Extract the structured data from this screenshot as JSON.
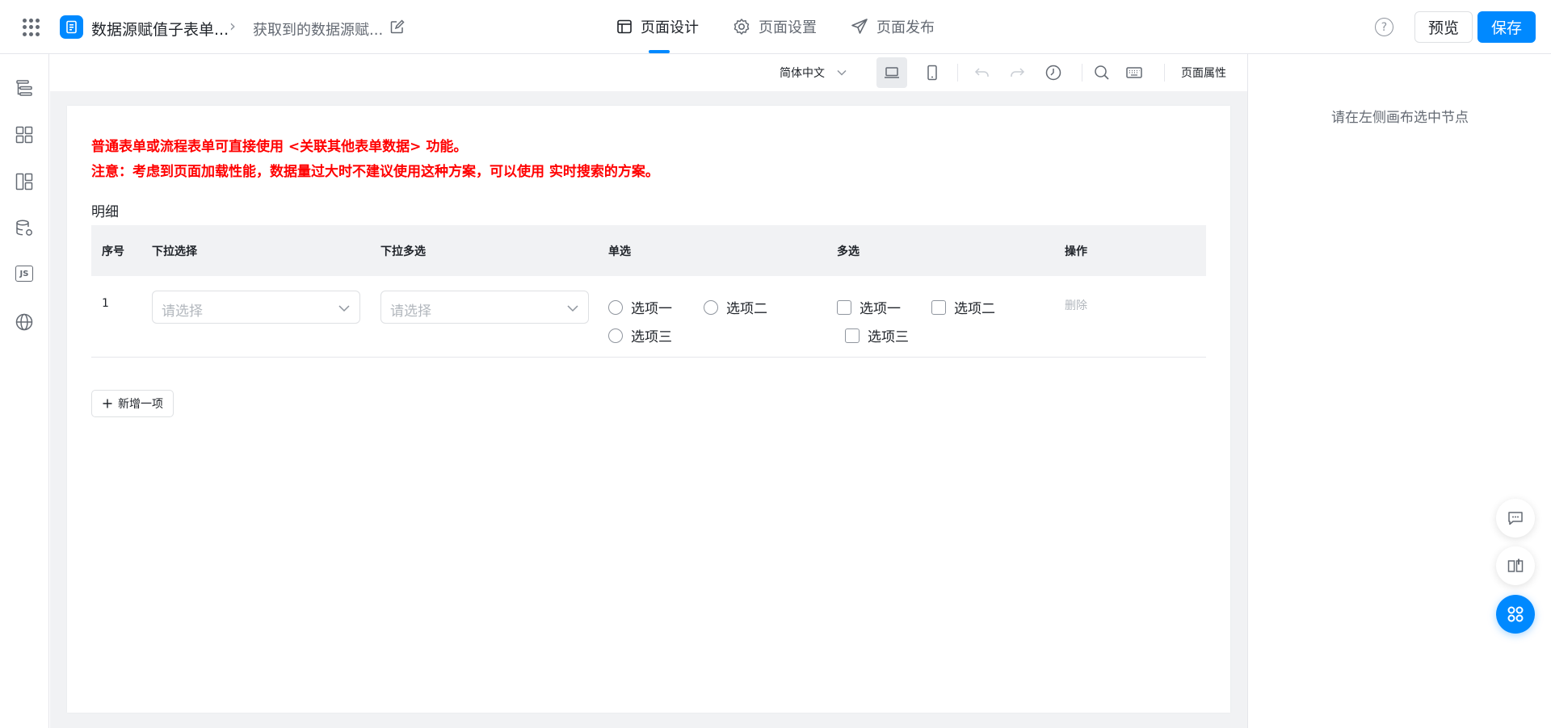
{
  "header": {
    "app_title": "数据源赋值子表单...",
    "page_name": "获取到的数据源赋...",
    "tabs": [
      {
        "label": "页面设计",
        "icon": "layout-icon",
        "active": true
      },
      {
        "label": "页面设置",
        "icon": "gear-icon",
        "active": false
      },
      {
        "label": "页面发布",
        "icon": "send-icon",
        "active": false
      }
    ],
    "help_label": "?",
    "preview_label": "预览",
    "save_label": "保存",
    "accent_color": "#0089ff"
  },
  "left_sidebar": {
    "icons": [
      "outline-tree-icon",
      "components-grid-icon",
      "layout-blocks-icon",
      "data-source-icon",
      "js-icon",
      "globe-icon"
    ],
    "js_label": "JS"
  },
  "toolbar": {
    "language": "简体中文",
    "device": "desktop",
    "page_props_label": "页面属性"
  },
  "canvas": {
    "notice_line1": "普通表单或流程表单可直接使用 <关联其他表单数据> 功能。",
    "notice_line2": "注意：考虑到页面加载性能，数据量过大时不建议使用这种方案，可以使用 实时搜索的方案。",
    "notice_color": "#ff0000",
    "section_title": "明细",
    "table": {
      "columns": [
        "序号",
        "下拉选择",
        "下拉多选",
        "单选",
        "多选",
        "操作"
      ],
      "rows": [
        {
          "index": "1",
          "select_placeholder": "请选择",
          "multiselect_placeholder": "请选择",
          "radio_options": [
            "选项一",
            "选项二",
            "选项三"
          ],
          "checkbox_options": [
            "选项一",
            "选项二",
            "选项三"
          ],
          "action": "删除"
        }
      ]
    },
    "add_item_label": "新增一项"
  },
  "right_panel": {
    "hint": "请在左侧画布选中节点"
  },
  "floating_buttons": [
    "feedback-icon",
    "guide-book-icon",
    "apps-icon"
  ]
}
